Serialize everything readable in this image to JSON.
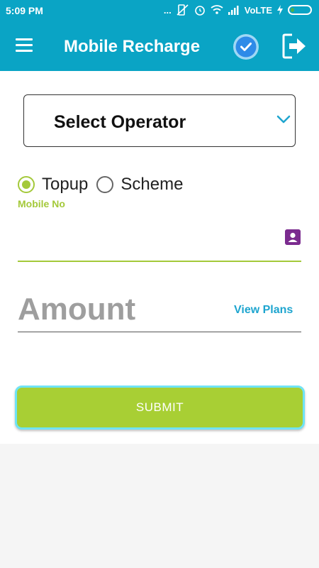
{
  "status_bar": {
    "time": "5:09 PM",
    "indicators": "...",
    "network": "VoLTE",
    "icons": [
      "mute-icon",
      "alarm-icon",
      "wifi-icon",
      "signal-icon",
      "charging-icon",
      "battery-icon"
    ]
  },
  "app_bar": {
    "title": "Mobile Recharge",
    "icons": [
      "menu-icon",
      "check-icon",
      "exit-icon"
    ]
  },
  "operator": {
    "label": "Select Operator"
  },
  "recharge_type": {
    "options": [
      {
        "label": "Topup",
        "selected": true
      },
      {
        "label": "Scheme",
        "selected": false
      }
    ]
  },
  "mobile": {
    "label": "Mobile No",
    "value": ""
  },
  "amount": {
    "placeholder": "Amount",
    "view_plans": "View Plans"
  },
  "submit": {
    "label": "SUBMIT"
  },
  "colors": {
    "primary": "#0aa4c5",
    "accent": "#a4c93a",
    "link": "#1ea5cf"
  }
}
